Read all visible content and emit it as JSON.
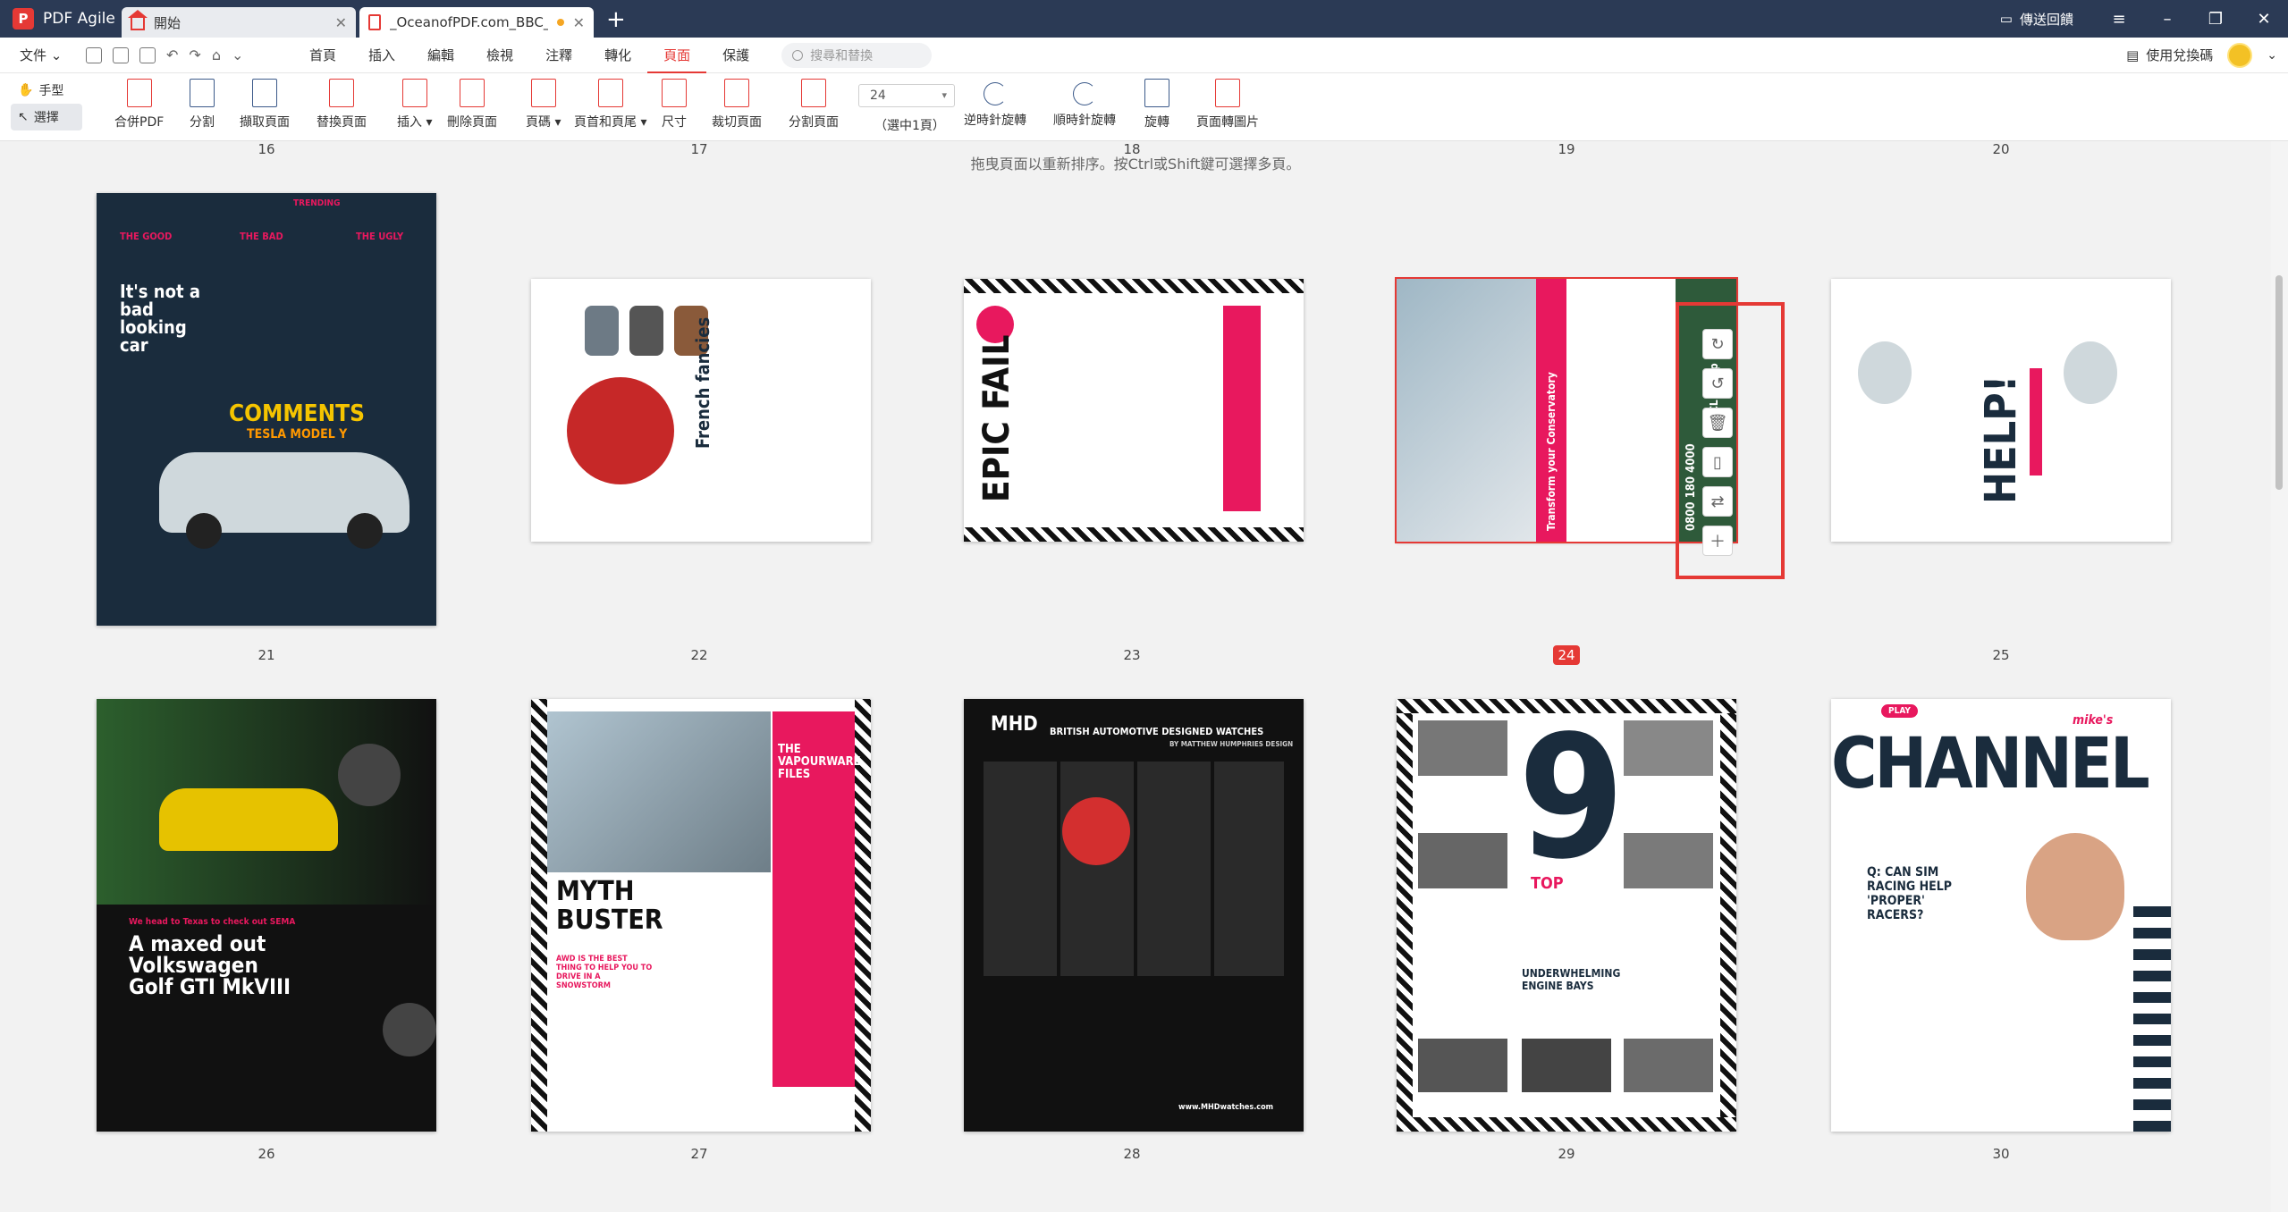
{
  "app": {
    "name": "PDF Agile",
    "logo_letter": "P"
  },
  "tabs": [
    {
      "label": "開始"
    },
    {
      "label": "_OceanofPDF.com_BBC_Top..."
    }
  ],
  "titlebar": {
    "send_review": "傳送回饋"
  },
  "menubar": {
    "file": "文件",
    "items": [
      "首頁",
      "插入",
      "編輯",
      "檢視",
      "注釋",
      "轉化",
      "頁面",
      "保護"
    ],
    "active": "頁面",
    "search_placeholder": "搜尋和替換",
    "redeem": "使用兌換碼"
  },
  "toolbar": {
    "hand": "手型",
    "select": "選擇",
    "tools": {
      "merge": "合併PDF",
      "split": "分割",
      "extract": "擷取頁面",
      "replace": "替換頁面",
      "insert": "插入",
      "delete": "刪除頁面",
      "margin": "頁碼",
      "header_footer": "頁首和頁尾",
      "size": "尺寸",
      "crop": "裁切頁面",
      "split_page": "分割頁面",
      "rotate_ccw": "逆時針旋轉",
      "rotate_cw": "順時針旋轉",
      "rotate": "旋轉",
      "to_image": "頁面轉圖片"
    },
    "page_value": "24",
    "page_note": "（選中1頁）"
  },
  "content": {
    "hint": "拖曳頁面以重新排序。按Ctrl或Shift鍵可選擇多頁。",
    "top_row_numbers": [
      "16",
      "17",
      "18",
      "19",
      "20"
    ],
    "row1_labels": [
      "21",
      "22",
      "23",
      "24",
      "25"
    ],
    "row2_labels": [
      "26",
      "27",
      "28",
      "29",
      "30"
    ],
    "current_page": "24"
  },
  "thumbnails": {
    "p21": {
      "title": "It's not a bad looking car",
      "sub": "COMMENTS",
      "brand": "TESLA MODEL Y",
      "tags": [
        "THE GOOD",
        "THE BAD",
        "THE UGLY"
      ]
    },
    "p22": {
      "title": "French fancies"
    },
    "p23": {
      "title": "EPIC FAIL"
    },
    "p24": {
      "side_text": "Transform your Conservatory",
      "phone": "0800 180 4000",
      "brand": "CL Group"
    },
    "p25": {
      "title": "HELP!"
    },
    "p26": {
      "title": "A maxed out Volkswagen Golf GTI MkVIII",
      "sub": "We head to Texas to check out SEMA"
    },
    "p27": {
      "title": "MYTH BUSTER",
      "side": "THE VAPOURWARE FILES",
      "quote": "AWD IS THE BEST THING TO HELP YOU TO DRIVE IN A SNOWSTORM"
    },
    "p28": {
      "brand": "MHD",
      "headline": "BRITISH AUTOMOTIVE DESIGNED WATCHES",
      "byline": "BY MATTHEW HUMPHRIES DESIGN",
      "url": "www.MHDwatches.com"
    },
    "p29": {
      "number": "9",
      "top": "TOP",
      "title": "UNDERWHELMING ENGINE BAYS"
    },
    "p30": {
      "title": "CHANNEL",
      "kicker": "mike's",
      "play": "PLAY",
      "question": "Q: CAN SIM RACING HELP 'PROPER' RACERS?"
    }
  },
  "colors": {
    "accent": "#e53935",
    "titlebar": "#2b3a55",
    "magenta": "#e8185e"
  }
}
